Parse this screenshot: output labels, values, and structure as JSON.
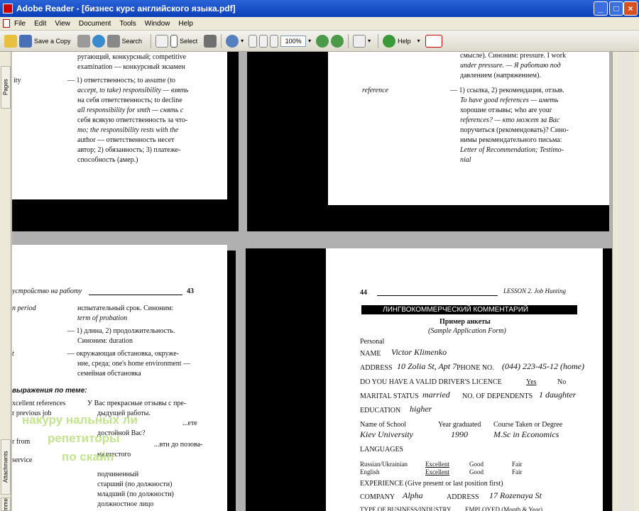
{
  "window": {
    "title": "Adobe Reader - [бизнес курс английского языка.pdf]",
    "minimize": "_",
    "maximize": "□",
    "close": "×"
  },
  "menu": [
    "File",
    "Edit",
    "View",
    "Document",
    "Tools",
    "Window",
    "Help"
  ],
  "toolbar": {
    "save_copy": "Save a Copy",
    "search": "Search",
    "select": "Select",
    "zoom": "100%",
    "help": "Help",
    "help_dd": "▾",
    "zoom_dd": "▾"
  },
  "sidepanel": {
    "pages": "Pages",
    "attachments": "Attachments",
    "comments": "Comments"
  },
  "pageA": {
    "l1": "ругающий, конкурсный; competitive",
    "l2": "examination — конкурсный экзамен",
    "lbl": "ity",
    "l3": "— 1) ответственность; to assume (to",
    "l4": "accept, to take) responsibility — взять",
    "l5": "на себя ответственность; to decline",
    "l6": "all responsibility for smth — снять с",
    "l7": "себя всякую ответственность за что-",
    "l8": "то; the responsibility rests with the",
    "l9": "author — ответственность несет",
    "l10": "автор; 2) обязанность; 3) платеже-",
    "l11": "способность (амер.)"
  },
  "pageB": {
    "l1": "смысле). Синоним: pressure. I work",
    "l2": "under pressure. — Я работаю под",
    "l3": "давлением (напряжением).",
    "lbl": "reference",
    "l4": "— 1) ссылка, 2) рекомендация, отзыв.",
    "l5": "To have good references — иметь",
    "l6": "хорошие отзывы; who are your",
    "l7": "references? — кто может за Вас",
    "l8": "поручиться (рекомендовать)? Сино-",
    "l9": "нимы рекомендательного письма:",
    "l10": "Letter of Recommendation; Testimo-",
    "l11": "nial"
  },
  "pageC": {
    "header": "устройство на работу",
    "page_no": "43",
    "lbl1": "n period",
    "r1": "испытательный срок. Синоним:",
    "r2": "term of probation",
    "r3": "— 1) длина, 2) продолжительность.",
    "r4": "Синоним: duration",
    "lbl2": "t",
    "r5": "— окружающая обстановка, окруже-",
    "r6": "ние, среда; one's home environment —",
    "r7": "семейная обстановка",
    "section": "выражения по теме:",
    "p1": "xcellent references",
    "p2": "r previous job",
    "p3": "r from",
    "p4": "service",
    "q1": "У Вас прекрасные отзывы с пре-",
    "q2": "дыдущей работы.",
    "q3": "...ете",
    "q4": "достойной Вас?",
    "q5": "...вти до позова-",
    "q6": "на шестого",
    "q7": "подчиненный",
    "q8": "старший (по должности)",
    "q9": "младший (по должности)",
    "q10": "должностное лицо",
    "q11": "...ы ..."
  },
  "pageD": {
    "page_no": "44",
    "header": "LESSON 2. Job Hunting",
    "banner": "ЛИНГВОКОММЕРЧЕСКИЙ КОММЕНТАРИЙ",
    "form_title": "Пример анкеты",
    "form_sub": "(Sample Application Form)",
    "personal": "Personal",
    "name_lbl": "NAME",
    "name_val": "Victor Klimenko",
    "addr_lbl": "ADDRESS",
    "addr_val": "10 Zolia St, Apt 7",
    "phone_lbl": "PHONE NO.",
    "phone_val": "(044) 223-45-12 (home)",
    "lic_lbl": "DO YOU HAVE A VALID DRIVER'S LICENCE",
    "lic_yes": "Yes",
    "lic_no": "No",
    "mar_lbl": "MARITAL STATUS",
    "mar_val": "married",
    "dep_lbl": "NO. OF DEPENDENTS",
    "dep_val": "1 daughter",
    "edu_lbl": "EDUCATION",
    "edu_val": "higher",
    "col1": "Name of School",
    "col2": "Year graduated",
    "col3": "Course Taken or Degree",
    "school": "Kiev University",
    "year": "1990",
    "degree": "M.Sc in Economics",
    "lang": "LANGUAGES",
    "lang1": "Russian/Ukrainian",
    "lang2": "English",
    "exc1": "Excellent",
    "exc2": "Excellent",
    "good1": "Good",
    "good2": "Good",
    "fair1": "Fair",
    "fair2": "Fair",
    "exp": "EXPERIENCE (Give present or last position first)",
    "comp_lbl": "COMPANY",
    "comp_val": "Alpha",
    "caddr_lbl": "ADDRESS",
    "caddr_val": "17 Rozenaya St",
    "biz": "TYPE OF BUSINESS/INDUSTRY",
    "emp": "EMPLOYED (Month & Year)"
  },
  "overlay": {
    "line1": "накуру нальных ли",
    "line2": "репетиторы",
    "line3": "по скайп"
  }
}
